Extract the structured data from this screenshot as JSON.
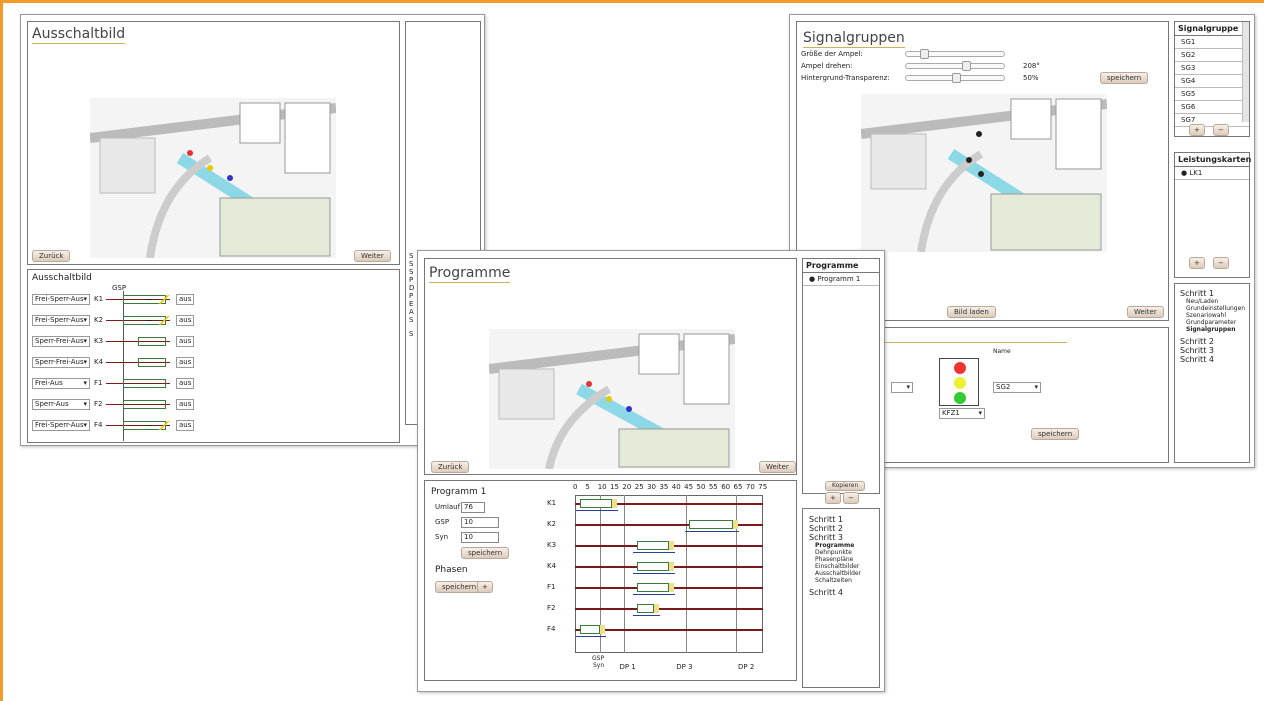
{
  "ausschalt": {
    "title": "Ausschaltbild",
    "back": "Zurück",
    "next": "Weiter",
    "sub_title": "Ausschaltbild",
    "gsp": "GSP",
    "rows": [
      {
        "sel": "Frei-Sperr-Aus",
        "k": "K1",
        "aus": "aus"
      },
      {
        "sel": "Frei-Sperr-Aus",
        "k": "K2",
        "aus": "aus"
      },
      {
        "sel": "Sperr-Frei-Aus",
        "k": "K3",
        "aus": "aus"
      },
      {
        "sel": "Sperr-Frei-Aus",
        "k": "K4",
        "aus": "aus"
      },
      {
        "sel": "Frei-Aus",
        "k": "F1",
        "aus": "aus"
      },
      {
        "sel": "Sperr-Aus",
        "k": "F2",
        "aus": "aus"
      },
      {
        "sel": "Frei-Sperr-Aus",
        "k": "F4",
        "aus": "aus"
      }
    ]
  },
  "middle_stub": {
    "lines": [
      "S",
      "S",
      "S",
      "P",
      "D",
      "P",
      "E",
      "A",
      "S",
      "S"
    ]
  },
  "signal": {
    "title": "Signalgruppen",
    "size_label": "Größe der Ampel:",
    "rot_label": "Ampel drehen:",
    "rot_value": "208°",
    "trans_label": "Hintergrund-Transparenz:",
    "trans_value": "50%",
    "save": "speichern",
    "load": "Bild laden",
    "next": "Weiter",
    "name_label": "Name",
    "sg_select": "SG2",
    "kfz_select": "KFZ1",
    "save2": "speichern",
    "group_list": {
      "title": "Signalgruppe",
      "items": [
        "SG1",
        "SG2",
        "SG3",
        "SG4",
        "SG5",
        "SG6",
        "SG7"
      ]
    },
    "lk_list": {
      "title": "Leistungskarten",
      "items": [
        "LK1"
      ]
    },
    "plus": "+",
    "minus": "−",
    "steps": [
      {
        "label": "Schritt 1",
        "subs": [
          "Neu/Laden",
          "Grundeinstellungen",
          "Szenariowahl",
          "Grundparameter",
          "Signalgruppen"
        ]
      },
      {
        "label": "Schritt 2",
        "subs": []
      },
      {
        "label": "Schritt 3",
        "subs": []
      },
      {
        "label": "Schritt 4",
        "subs": []
      }
    ]
  },
  "programme": {
    "title": "Programme",
    "back": "Zurück",
    "next": "Weiter",
    "list_title": "Programme",
    "list_items": [
      "Programm 1"
    ],
    "copy": "Kopieren",
    "plus": "+",
    "minus": "−",
    "prog_title": "Programm 1",
    "umlauf_label": "Umlauf",
    "umlauf": "76",
    "gsp_label": "GSP",
    "gsp": "10",
    "syn_label": "Syn",
    "syn": "10",
    "save": "speichern",
    "phasen": "Phasen",
    "phasen_save": "speichern",
    "phasen_plus": "+",
    "ticks": [
      "0",
      "5",
      "10",
      "15",
      "20",
      "25",
      "30",
      "35",
      "40",
      "45",
      "50",
      "55",
      "60",
      "65",
      "70",
      "75"
    ],
    "rows": [
      "K1",
      "K2",
      "K3",
      "K4",
      "F1",
      "F2",
      "F4"
    ],
    "bottom": {
      "gsp": "GSP",
      "syn": "Syn",
      "dp1": "DP 1",
      "dp3": "DP 3",
      "dp2": "DP 2"
    },
    "steps": [
      {
        "label": "Schritt 1",
        "subs": []
      },
      {
        "label": "Schritt 2",
        "subs": []
      },
      {
        "label": "Schritt 3",
        "subs": [
          "Programme",
          "Dehnpunkte",
          "Phasenpläne",
          "Einschaltbilder",
          "Ausschaltbilder",
          "Schaltzeiten"
        ]
      },
      {
        "label": "Schritt 4",
        "subs": []
      }
    ]
  }
}
